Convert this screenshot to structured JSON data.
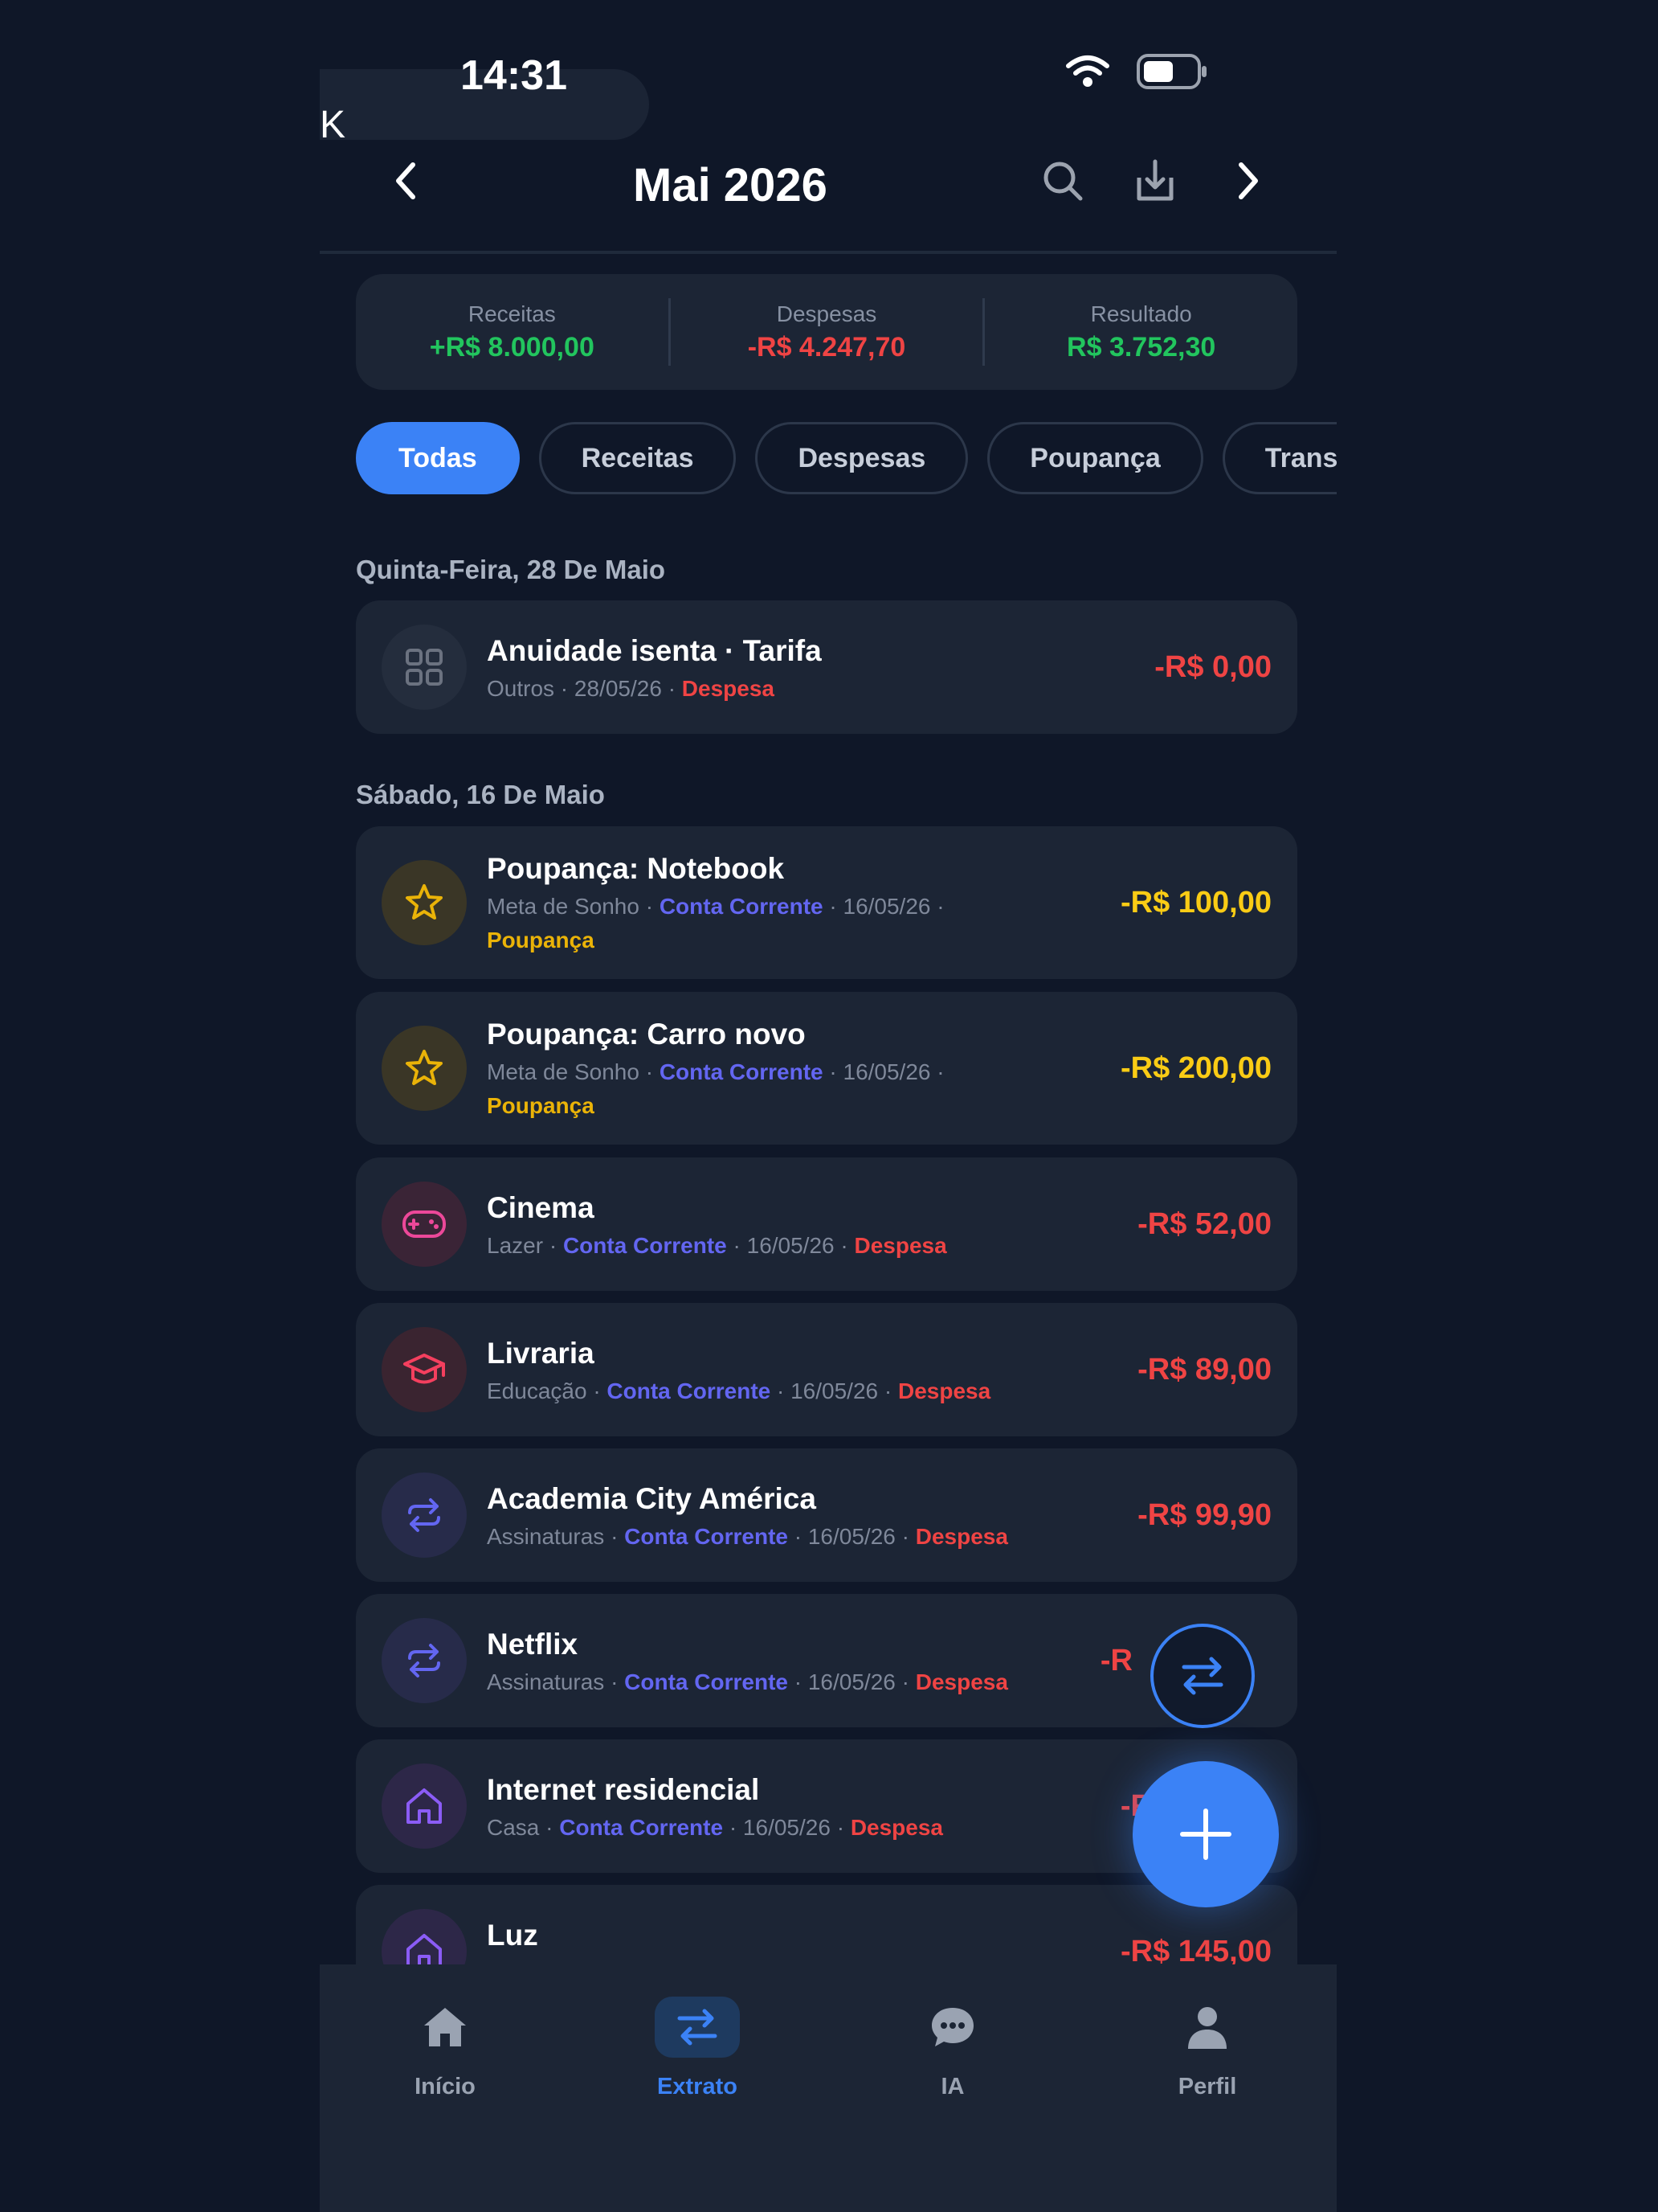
{
  "status": {
    "time": "14:31",
    "back_app": "K"
  },
  "header": {
    "title": "Mai 2026"
  },
  "summary": {
    "income_label": "Receitas",
    "income_value": "+R$ 8.000,00",
    "expense_label": "Despesas",
    "expense_value": "-R$ 4.247,70",
    "result_label": "Resultado",
    "result_value": "R$ 3.752,30"
  },
  "filters": [
    "Todas",
    "Receitas",
    "Despesas",
    "Poupança",
    "Trans"
  ],
  "days": [
    {
      "label": "Quinta-Feira, 28 De Maio"
    },
    {
      "label": "Sábado, 16 De Maio"
    }
  ],
  "transactions": [
    {
      "title": "Anuidade isenta · Tarifa",
      "category": "Outros · ",
      "account": "",
      "date": "28/05/26 · ",
      "type": "Despesa",
      "amount": "-R$ 0,00"
    },
    {
      "title": "Poupança: Notebook",
      "category": "Meta de Sonho · ",
      "account": "Conta Corrente",
      "date": " · 16/05/26 · ",
      "type": "Poupança",
      "amount": "-R$ 100,00"
    },
    {
      "title": "Poupança: Carro novo",
      "category": "Meta de Sonho · ",
      "account": "Conta Corrente",
      "date": " · 16/05/26 · ",
      "type": "Poupança",
      "amount": "-R$ 200,00"
    },
    {
      "title": "Cinema",
      "category": "Lazer · ",
      "account": "Conta Corrente",
      "date": " · 16/05/26 · ",
      "type": "Despesa",
      "amount": "-R$ 52,00"
    },
    {
      "title": "Livraria",
      "category": "Educação · ",
      "account": "Conta Corrente",
      "date": " · 16/05/26 · ",
      "type": "Despesa",
      "amount": "-R$ 89,00"
    },
    {
      "title": "Academia City América",
      "category": "Assinaturas · ",
      "account": "Conta Corrente",
      "date": " · 16/05/26 · ",
      "type": "Despesa",
      "amount": "-R$ 99,90"
    },
    {
      "title": "Netflix",
      "category": "Assinaturas · ",
      "account": "Conta Corrente",
      "date": " · 16/05/26 · ",
      "type": "Despesa",
      "amount": "-R"
    },
    {
      "title": "Internet residencial",
      "category": "Casa · ",
      "account": "Conta Corrente",
      "date": " · 16/05/26 · ",
      "type": "Despesa",
      "amount": "-R"
    },
    {
      "title": "Luz",
      "amount": "-R$ 145,00"
    }
  ],
  "tabbar": [
    {
      "label": "Início",
      "icon": "home-icon"
    },
    {
      "label": "Extrato",
      "icon": "transfer-icon"
    },
    {
      "label": "IA",
      "icon": "chat-icon"
    },
    {
      "label": "Perfil",
      "icon": "user-icon"
    }
  ],
  "colors": {
    "accent": "#3b82f6",
    "expense": "#ef4444",
    "savings": "#facc15",
    "income": "#22c55e",
    "background": "#0f1728",
    "card": "#1c2535"
  }
}
